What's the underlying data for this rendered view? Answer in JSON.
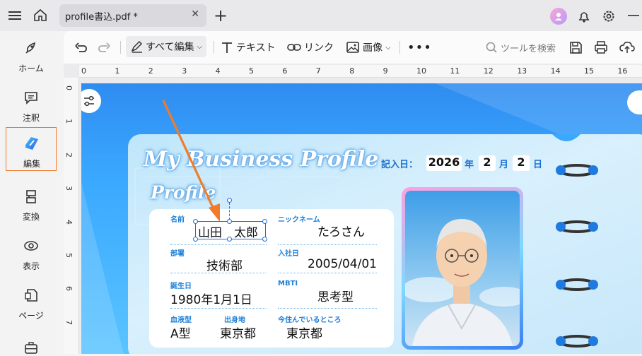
{
  "tab": {
    "title": "profile書込.pdf *"
  },
  "sidebar": {
    "items": [
      {
        "label": "ホーム"
      },
      {
        "label": "注釈"
      },
      {
        "label": "編集"
      },
      {
        "label": "変換"
      },
      {
        "label": "表示"
      },
      {
        "label": "ページ"
      }
    ]
  },
  "toolbar": {
    "edit_all": "すべて編集",
    "text": "テキスト",
    "link": "リンク",
    "image": "画像",
    "search_placeholder": "ツールを検索"
  },
  "ruler": {
    "h": [
      "0",
      "1",
      "2",
      "3",
      "4",
      "5",
      "6",
      "7",
      "8",
      "9",
      "10",
      "11",
      "12",
      "13",
      "14",
      "15",
      "16"
    ],
    "v": [
      "0",
      "1",
      "2",
      "3",
      "4",
      "5",
      "6",
      "7"
    ]
  },
  "document": {
    "title": "My Business Profile",
    "date_label": "記入日：",
    "year": "2026",
    "year_unit": "年",
    "month": "2",
    "month_unit": "月",
    "day": "2",
    "day_unit": "日",
    "profile_heading": "Profile",
    "fields": {
      "name_label": "名前",
      "name_value": "山田　太郎",
      "nickname_label": "ニックネーム",
      "nickname_value": "たろさん",
      "dept_label": "部署",
      "dept_value": "技術部",
      "join_label": "入社日",
      "join_value": "2005/04/01",
      "birth_label": "誕生日",
      "birth_value": "1980年1月1日",
      "mbti_label": "MBTI",
      "mbti_value": "思考型",
      "blood_label": "血液型",
      "blood_value": "A型",
      "origin_label": "出身地",
      "origin_value": "東京都",
      "live_label": "今住んでいるところ",
      "live_value": "東京都"
    }
  },
  "colors": {
    "accent": "#f07c2a",
    "brand_blue": "#1d7fd6",
    "page_blue": "#3aa8ff"
  }
}
